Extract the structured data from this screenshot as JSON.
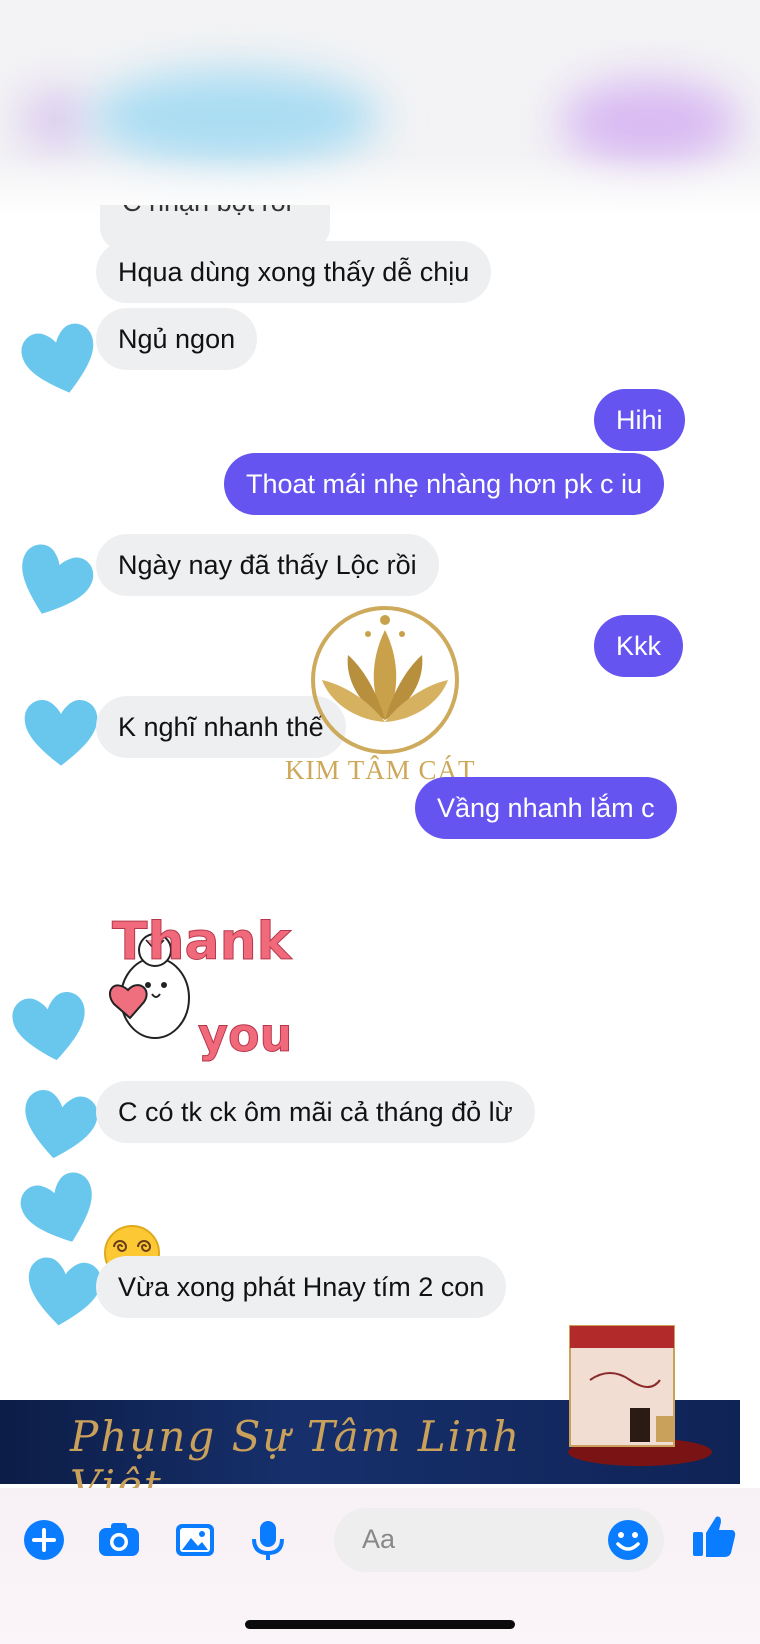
{
  "conversation": {
    "messages": [
      {
        "side": "in",
        "text": "C nhận bột rồi"
      },
      {
        "side": "in",
        "text": "Hqua dùng xong thấy dễ chịu"
      },
      {
        "side": "in",
        "text": "Ngủ ngon"
      },
      {
        "side": "out",
        "text": "Hihi"
      },
      {
        "side": "out",
        "text": "Thoat mái nhẹ nhàng hơn pk c iu"
      },
      {
        "side": "in",
        "text": "Ngày nay đã thấy Lộc rồi"
      },
      {
        "side": "out",
        "text": "Kkk"
      },
      {
        "side": "in",
        "text": "K nghĩ nhanh thế"
      },
      {
        "side": "out",
        "text": "Vầng nhanh lắm c"
      },
      {
        "side": "in",
        "text": "C có tk ck ôm mãi cả tháng đỏ lừ"
      },
      {
        "side": "in",
        "text": "Vừa xong phát Hnay tím 2 con"
      }
    ],
    "sticker": {
      "line1": "Thank",
      "line2": "you"
    },
    "emoji_name": "dizzy-face-emoji"
  },
  "watermark": {
    "brand": "KIM TÂM CÁT",
    "color": "#c9a14a"
  },
  "banner": {
    "text": "Phụng Sự Tâm Linh Việt"
  },
  "composer": {
    "placeholder": "Aa"
  },
  "colors": {
    "outgoing": "#6654f0",
    "incoming": "#eeeff1",
    "accent": "#0a7cff",
    "avatar": "#69c7ee"
  }
}
